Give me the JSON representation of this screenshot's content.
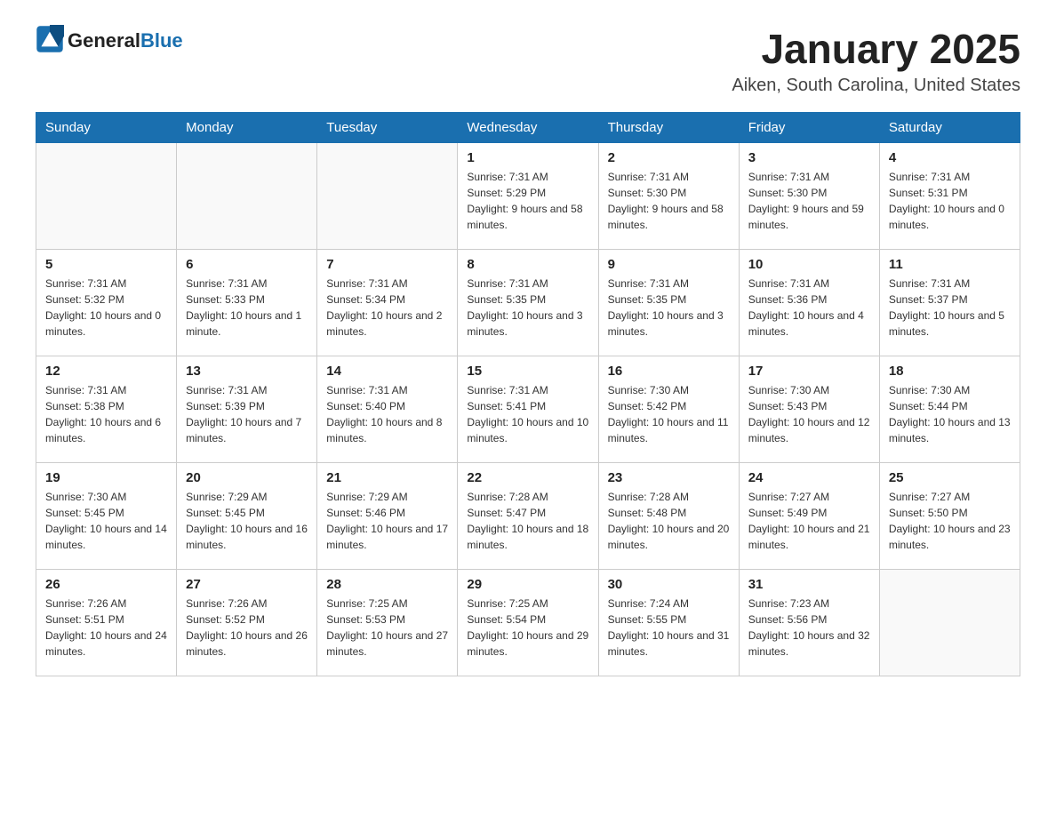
{
  "header": {
    "logo_text_general": "General",
    "logo_text_blue": "Blue",
    "month_title": "January 2025",
    "location": "Aiken, South Carolina, United States"
  },
  "weekdays": [
    "Sunday",
    "Monday",
    "Tuesday",
    "Wednesday",
    "Thursday",
    "Friday",
    "Saturday"
  ],
  "weeks": [
    [
      {
        "day": "",
        "sunrise": "",
        "sunset": "",
        "daylight": "",
        "empty": true
      },
      {
        "day": "",
        "sunrise": "",
        "sunset": "",
        "daylight": "",
        "empty": true
      },
      {
        "day": "",
        "sunrise": "",
        "sunset": "",
        "daylight": "",
        "empty": true
      },
      {
        "day": "1",
        "sunrise": "Sunrise: 7:31 AM",
        "sunset": "Sunset: 5:29 PM",
        "daylight": "Daylight: 9 hours and 58 minutes."
      },
      {
        "day": "2",
        "sunrise": "Sunrise: 7:31 AM",
        "sunset": "Sunset: 5:30 PM",
        "daylight": "Daylight: 9 hours and 58 minutes."
      },
      {
        "day": "3",
        "sunrise": "Sunrise: 7:31 AM",
        "sunset": "Sunset: 5:30 PM",
        "daylight": "Daylight: 9 hours and 59 minutes."
      },
      {
        "day": "4",
        "sunrise": "Sunrise: 7:31 AM",
        "sunset": "Sunset: 5:31 PM",
        "daylight": "Daylight: 10 hours and 0 minutes."
      }
    ],
    [
      {
        "day": "5",
        "sunrise": "Sunrise: 7:31 AM",
        "sunset": "Sunset: 5:32 PM",
        "daylight": "Daylight: 10 hours and 0 minutes."
      },
      {
        "day": "6",
        "sunrise": "Sunrise: 7:31 AM",
        "sunset": "Sunset: 5:33 PM",
        "daylight": "Daylight: 10 hours and 1 minute."
      },
      {
        "day": "7",
        "sunrise": "Sunrise: 7:31 AM",
        "sunset": "Sunset: 5:34 PM",
        "daylight": "Daylight: 10 hours and 2 minutes."
      },
      {
        "day": "8",
        "sunrise": "Sunrise: 7:31 AM",
        "sunset": "Sunset: 5:35 PM",
        "daylight": "Daylight: 10 hours and 3 minutes."
      },
      {
        "day": "9",
        "sunrise": "Sunrise: 7:31 AM",
        "sunset": "Sunset: 5:35 PM",
        "daylight": "Daylight: 10 hours and 3 minutes."
      },
      {
        "day": "10",
        "sunrise": "Sunrise: 7:31 AM",
        "sunset": "Sunset: 5:36 PM",
        "daylight": "Daylight: 10 hours and 4 minutes."
      },
      {
        "day": "11",
        "sunrise": "Sunrise: 7:31 AM",
        "sunset": "Sunset: 5:37 PM",
        "daylight": "Daylight: 10 hours and 5 minutes."
      }
    ],
    [
      {
        "day": "12",
        "sunrise": "Sunrise: 7:31 AM",
        "sunset": "Sunset: 5:38 PM",
        "daylight": "Daylight: 10 hours and 6 minutes."
      },
      {
        "day": "13",
        "sunrise": "Sunrise: 7:31 AM",
        "sunset": "Sunset: 5:39 PM",
        "daylight": "Daylight: 10 hours and 7 minutes."
      },
      {
        "day": "14",
        "sunrise": "Sunrise: 7:31 AM",
        "sunset": "Sunset: 5:40 PM",
        "daylight": "Daylight: 10 hours and 8 minutes."
      },
      {
        "day": "15",
        "sunrise": "Sunrise: 7:31 AM",
        "sunset": "Sunset: 5:41 PM",
        "daylight": "Daylight: 10 hours and 10 minutes."
      },
      {
        "day": "16",
        "sunrise": "Sunrise: 7:30 AM",
        "sunset": "Sunset: 5:42 PM",
        "daylight": "Daylight: 10 hours and 11 minutes."
      },
      {
        "day": "17",
        "sunrise": "Sunrise: 7:30 AM",
        "sunset": "Sunset: 5:43 PM",
        "daylight": "Daylight: 10 hours and 12 minutes."
      },
      {
        "day": "18",
        "sunrise": "Sunrise: 7:30 AM",
        "sunset": "Sunset: 5:44 PM",
        "daylight": "Daylight: 10 hours and 13 minutes."
      }
    ],
    [
      {
        "day": "19",
        "sunrise": "Sunrise: 7:30 AM",
        "sunset": "Sunset: 5:45 PM",
        "daylight": "Daylight: 10 hours and 14 minutes."
      },
      {
        "day": "20",
        "sunrise": "Sunrise: 7:29 AM",
        "sunset": "Sunset: 5:45 PM",
        "daylight": "Daylight: 10 hours and 16 minutes."
      },
      {
        "day": "21",
        "sunrise": "Sunrise: 7:29 AM",
        "sunset": "Sunset: 5:46 PM",
        "daylight": "Daylight: 10 hours and 17 minutes."
      },
      {
        "day": "22",
        "sunrise": "Sunrise: 7:28 AM",
        "sunset": "Sunset: 5:47 PM",
        "daylight": "Daylight: 10 hours and 18 minutes."
      },
      {
        "day": "23",
        "sunrise": "Sunrise: 7:28 AM",
        "sunset": "Sunset: 5:48 PM",
        "daylight": "Daylight: 10 hours and 20 minutes."
      },
      {
        "day": "24",
        "sunrise": "Sunrise: 7:27 AM",
        "sunset": "Sunset: 5:49 PM",
        "daylight": "Daylight: 10 hours and 21 minutes."
      },
      {
        "day": "25",
        "sunrise": "Sunrise: 7:27 AM",
        "sunset": "Sunset: 5:50 PM",
        "daylight": "Daylight: 10 hours and 23 minutes."
      }
    ],
    [
      {
        "day": "26",
        "sunrise": "Sunrise: 7:26 AM",
        "sunset": "Sunset: 5:51 PM",
        "daylight": "Daylight: 10 hours and 24 minutes."
      },
      {
        "day": "27",
        "sunrise": "Sunrise: 7:26 AM",
        "sunset": "Sunset: 5:52 PM",
        "daylight": "Daylight: 10 hours and 26 minutes."
      },
      {
        "day": "28",
        "sunrise": "Sunrise: 7:25 AM",
        "sunset": "Sunset: 5:53 PM",
        "daylight": "Daylight: 10 hours and 27 minutes."
      },
      {
        "day": "29",
        "sunrise": "Sunrise: 7:25 AM",
        "sunset": "Sunset: 5:54 PM",
        "daylight": "Daylight: 10 hours and 29 minutes."
      },
      {
        "day": "30",
        "sunrise": "Sunrise: 7:24 AM",
        "sunset": "Sunset: 5:55 PM",
        "daylight": "Daylight: 10 hours and 31 minutes."
      },
      {
        "day": "31",
        "sunrise": "Sunrise: 7:23 AM",
        "sunset": "Sunset: 5:56 PM",
        "daylight": "Daylight: 10 hours and 32 minutes."
      },
      {
        "day": "",
        "sunrise": "",
        "sunset": "",
        "daylight": "",
        "empty": true
      }
    ]
  ]
}
